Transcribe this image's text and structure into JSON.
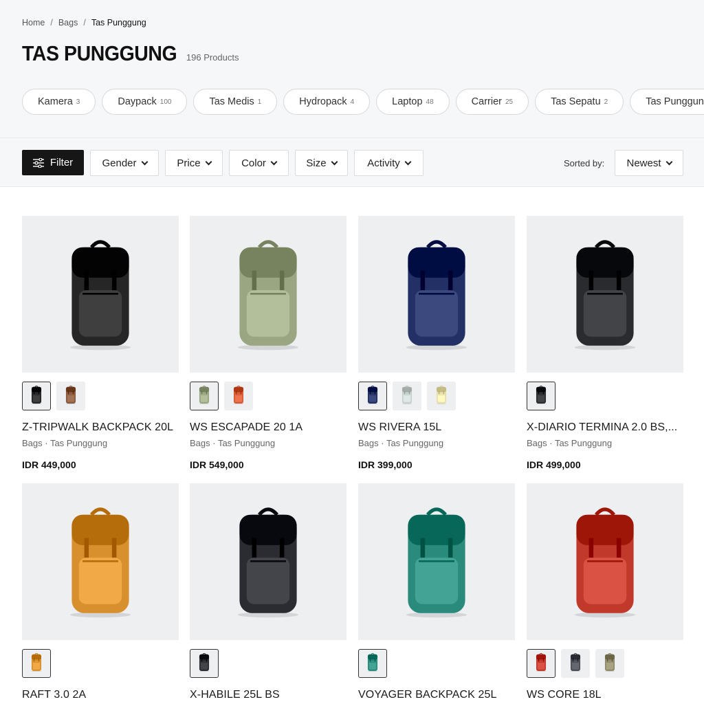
{
  "breadcrumb": {
    "home": "Home",
    "sep": "/",
    "bags": "Bags",
    "current": "Tas Punggung"
  },
  "header": {
    "title": "TAS PUNGGUNG",
    "count": "196 Products"
  },
  "categories": [
    {
      "label": "Kamera",
      "count": "3"
    },
    {
      "label": "Daypack",
      "count": "100"
    },
    {
      "label": "Tas Medis",
      "count": "1"
    },
    {
      "label": "Hydropack",
      "count": "4"
    },
    {
      "label": "Laptop",
      "count": "48"
    },
    {
      "label": "Carrier",
      "count": "25"
    },
    {
      "label": "Tas Sepatu",
      "count": "2"
    },
    {
      "label": "Tas Punggung",
      "count": ""
    }
  ],
  "filters": {
    "filter_label": "Filter",
    "gender": "Gender",
    "price": "Price",
    "color": "Color",
    "size": "Size",
    "activity": "Activity",
    "sorted_label": "Sorted by:",
    "sorted_value": "Newest"
  },
  "products": [
    {
      "name": "Z-TRIPWALK BACKPACK 20L",
      "category": "Bags · Tas Punggung",
      "price": "IDR 449,000",
      "colors": [
        "#262626",
        "#8a5a3c"
      ]
    },
    {
      "name": "WS ESCAPADE 20 1A",
      "category": "Bags · Tas Punggung",
      "price": "IDR 549,000",
      "colors": [
        "#9aa581",
        "#d35a34"
      ]
    },
    {
      "name": "WS RIVERA 15L",
      "category": "Bags · Tas Punggung",
      "price": "IDR 399,000",
      "colors": [
        "#223066",
        "#c5cfcc",
        "#e6dfa8"
      ]
    },
    {
      "name": "X-DIARIO TERMINA 2.0 BS,...",
      "category": "Bags · Tas Punggung",
      "price": "IDR 499,000",
      "colors": [
        "#2a2b2e"
      ]
    },
    {
      "name": "RAFT 3.0 2A",
      "category": "",
      "price": "",
      "colors": [
        "#d8902e"
      ]
    },
    {
      "name": "X-HABILE 25L BS",
      "category": "",
      "price": "",
      "colors": [
        "#2a2c31"
      ]
    },
    {
      "name": "VOYAGER BACKPACK 25L",
      "category": "",
      "price": "",
      "colors": [
        "#2a8a7b"
      ]
    },
    {
      "name": "WS CORE 18L",
      "category": "",
      "price": "",
      "colors": [
        "#c0392b",
        "#4b4f55",
        "#8f8a6a"
      ]
    }
  ],
  "colors": {
    "accent": "#161616",
    "page_bg": "#f6f7f9",
    "image_bg": "#eeeff1"
  },
  "icons": {
    "filter": "sliders-icon",
    "dropdown": "chevron-down-icon",
    "product": "backpack-icon"
  }
}
